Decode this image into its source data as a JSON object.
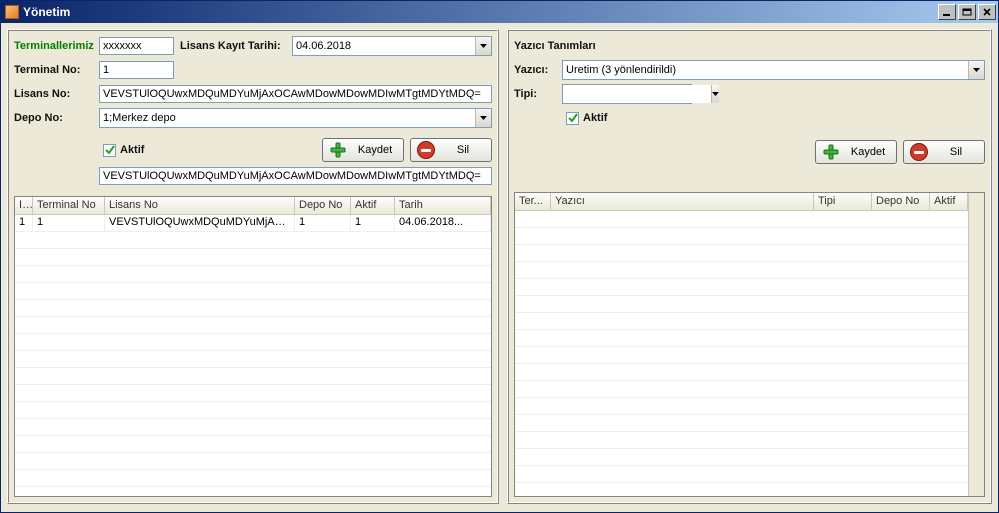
{
  "window": {
    "title": "Yönetim"
  },
  "left": {
    "group_label": "Terminallerimiz",
    "asterisks": "xxxxxxx",
    "license_date_label": "Lisans Kayıt Tarihi:",
    "license_date": "04.06.2018",
    "terminal_no_label": "Terminal No:",
    "terminal_no": "1",
    "license_no_label": "Lisans No:",
    "license_no": "VEVSTUlOQUwxMDQuMDYuMjAxOCAwMDowMDowMDIwMTgtMDYtMDQ=",
    "depo_no_label": "Depo No:",
    "depo_no": "1;Merkez depo",
    "aktif_label": "Aktif",
    "btn_save": "Kaydet",
    "btn_delete": "Sil",
    "readonly_line": "VEVSTUlOQUwxMDQuMDYuMjAxOCAwMDowMDowMDIwMTgtMDYtMDQ=",
    "columns": [
      "I...",
      "Terminal No",
      "Lisans No",
      "Depo No",
      "Aktif",
      "Tarih"
    ],
    "rows": [
      {
        "id": "1",
        "terminal_no": "1",
        "lisans_no": "VEVSTUlOQUwxMDQuMDYuMjAxO...",
        "depo_no": "1",
        "aktif": "1",
        "tarih": "04.06.2018..."
      }
    ]
  },
  "right": {
    "group_label": "Yazıcı Tanımları",
    "yazici_label": "Yazıcı:",
    "yazici": "Uretim (3 yönlendirildi)",
    "tipi_label": "Tipi:",
    "tipi": "",
    "aktif_label": "Aktif",
    "btn_save": "Kaydet",
    "btn_delete": "Sil",
    "columns": [
      "Ter...",
      "Yazıcı",
      "Tipi",
      "Depo No",
      "Aktif"
    ],
    "rows": []
  }
}
